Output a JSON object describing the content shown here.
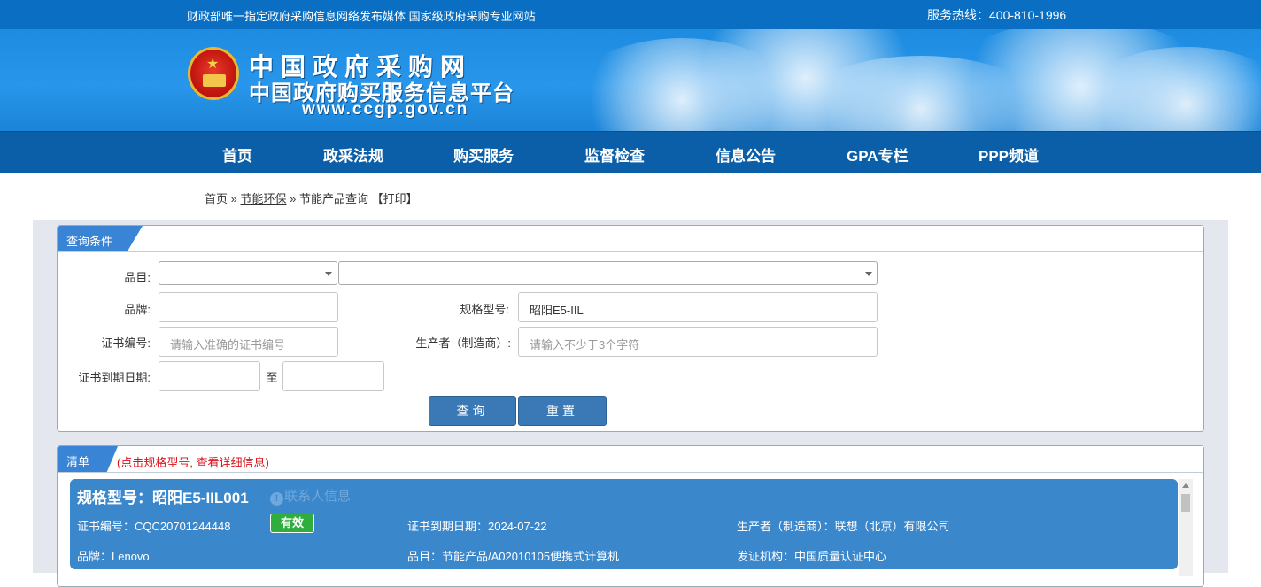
{
  "topbar": {
    "left_text": "财政部唯一指定政府采购信息网络发布媒体 国家级政府采购专业网站",
    "hotline": "服务热线：400-810-1996"
  },
  "banner": {
    "logo_cn": "中国政府采购网",
    "logo_sub": "中国政府购买服务信息平台",
    "logo_url": "www.ccgp.gov.cn"
  },
  "nav": {
    "items": [
      "首页",
      "政采法规",
      "购买服务",
      "监督检查",
      "信息公告",
      "GPA专栏",
      "PPP频道"
    ]
  },
  "breadcrumb": {
    "home": "首页",
    "sep1": "»",
    "section": "节能环保",
    "sep2": "»",
    "page": "节能产品查询",
    "print": "【打印】"
  },
  "query": {
    "header": "查询条件",
    "category_label": "品目:",
    "brand_label": "品牌:",
    "brand_value": "",
    "model_label": "规格型号:",
    "model_value": "昭阳E5-IIL",
    "cert_label": "证书编号:",
    "cert_placeholder": "请输入准确的证书编号",
    "maker_label": "生产者（制造商）:",
    "maker_placeholder": "请输入不少于3个字符",
    "expiry_label": "证书到期日期:",
    "to_label": "至",
    "search_btn": "查询",
    "reset_btn": "重置"
  },
  "list": {
    "header": "清单",
    "hint": "(点击规格型号, 查看详细信息)",
    "item": {
      "title": "规格型号：昭阳E5-IIL001",
      "contact": "联系人信息",
      "cert": "证书编号：CQC20701244448",
      "status": "有效",
      "expiry": "证书到期日期：2024-07-22",
      "maker": "生产者（制造商）：联想（北京）有限公司",
      "brand": "品牌：Lenovo",
      "category": "品目：节能产品/A02010105便携式计算机",
      "issuer": "发证机构：中国质量认证中心"
    }
  },
  "colors": {
    "topbar": "#0a6fc2",
    "nav": "#0b5ea8",
    "tab": "#3a84d6",
    "card": "#3b87cb",
    "button": "#3a79b6",
    "badge": "#2fae3e",
    "hint": "#d9131a"
  }
}
